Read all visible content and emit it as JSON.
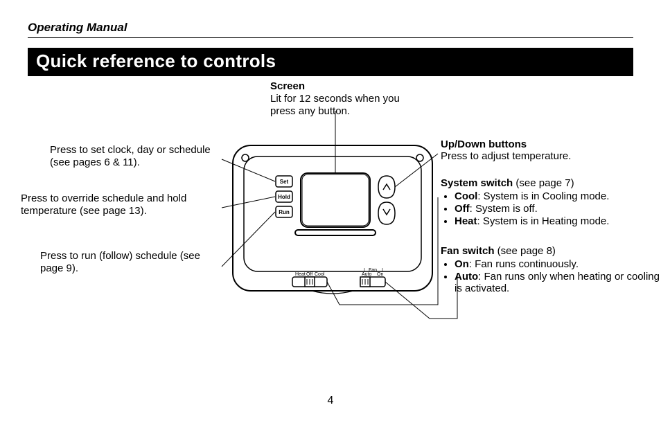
{
  "header": {
    "manual": "Operating Manual",
    "title": "Quick reference to controls"
  },
  "screen": {
    "heading": "Screen",
    "body": "Lit for 12 seconds when you press any button."
  },
  "left": {
    "set": "Press to set clock, day or schedule (see pages 6 & 11).",
    "hold": "Press to override schedule and hold temperature (see page 13).",
    "run": "Press to run (follow) schedule (see page 9)."
  },
  "right": {
    "updown": {
      "heading": "Up/Down buttons",
      "body": "Press to adjust temperature."
    },
    "system": {
      "heading": "System switch",
      "note": " (see page 7)",
      "items": [
        {
          "b": "Cool",
          "t": ": System is in Cooling mode."
        },
        {
          "b": "Off",
          "t": ": System is off."
        },
        {
          "b": "Heat",
          "t": ": System is in Heating mode."
        }
      ]
    },
    "fan": {
      "heading": "Fan switch",
      "note": " (see page 8)",
      "items": [
        {
          "b": "On",
          "t": ": Fan runs continuously."
        },
        {
          "b": "Auto",
          "t": ": Fan runs only when heating or cooling is activated."
        }
      ]
    }
  },
  "device": {
    "btn": {
      "set": "Set",
      "hold": "Hold",
      "run": "Run"
    },
    "system_sw": {
      "labels": [
        "Heat",
        "Off",
        "Cool"
      ]
    },
    "fan_sw": {
      "title": "Fan",
      "labels": [
        "Auto",
        "On"
      ]
    }
  },
  "page": "4"
}
